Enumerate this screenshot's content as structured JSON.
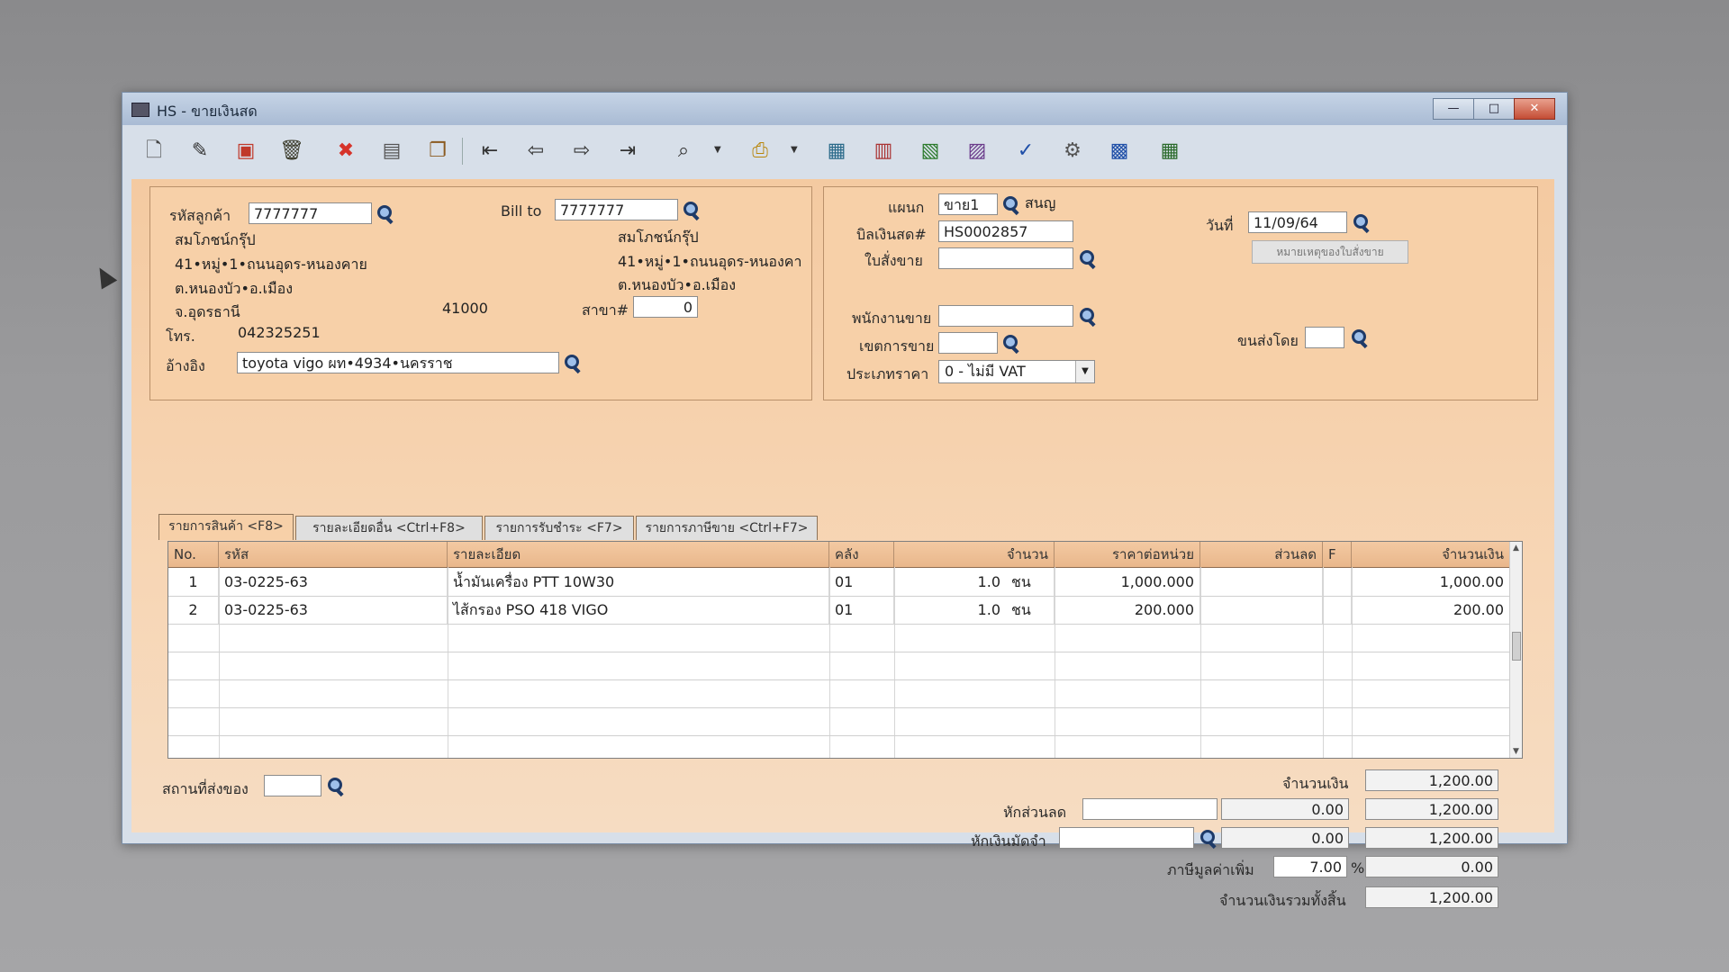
{
  "window": {
    "title": "HS - ขายเงินสด",
    "min": "—",
    "max": "□",
    "close": "✕"
  },
  "toolbar": [
    {
      "name": "new-document-icon",
      "glyph": "🗋"
    },
    {
      "name": "edit-icon",
      "glyph": "✎"
    },
    {
      "name": "void-icon",
      "glyph": "▣"
    },
    {
      "name": "delete-bin-icon",
      "glyph": "🗑"
    },
    {
      "name": "cancel-icon",
      "glyph": "✖"
    },
    {
      "name": "save-icon",
      "glyph": "▤"
    },
    {
      "name": "copy-icon",
      "glyph": "❐"
    },
    {
      "name": "first-record-icon",
      "glyph": "⇤"
    },
    {
      "name": "previous-record-icon",
      "glyph": "⇦"
    },
    {
      "name": "next-record-icon",
      "glyph": "⇨"
    },
    {
      "name": "last-record-icon",
      "glyph": "⇥"
    },
    {
      "name": "find-icon",
      "glyph": "⌕"
    },
    {
      "name": "print-icon",
      "glyph": "⎙"
    },
    {
      "name": "report-icon",
      "glyph": "▦"
    },
    {
      "name": "form-icon",
      "glyph": "▥"
    },
    {
      "name": "sign-icon",
      "glyph": "▧"
    },
    {
      "name": "rejection-icon",
      "glyph": "▨"
    },
    {
      "name": "approve-icon",
      "glyph": "✓"
    },
    {
      "name": "tools-icon",
      "glyph": "⚙"
    },
    {
      "name": "ok-document-icon",
      "glyph": "▩"
    },
    {
      "name": "calculator-icon",
      "glyph": "▦"
    }
  ],
  "customer": {
    "code_label": "รหัสลูกค้า",
    "code": "7777777",
    "name": "สมโภชน์กรุ๊ป",
    "addr1": "41•หมู่•1•ถนนอุดร-หนองคาย",
    "addr2": "ต.หนองบัว•อ.เมือง",
    "province": "จ.อุดรธานี",
    "postcode": "41000",
    "tel_label": "โทร.",
    "tel": "042325251",
    "ref_label": "อ้างอิง",
    "ref": "toyota vigo ผท•4934•นครราช"
  },
  "bill_to": {
    "label": "Bill to",
    "code": "7777777",
    "name": "สมโภชน์กรุ๊ป",
    "addr1": "41•หมู่•1•ถนนอุดร-หนองคา",
    "addr2": "ต.หนองบัว•อ.เมือง",
    "branch_label": "สาขา#",
    "branch": "0"
  },
  "doc": {
    "dept_label": "แผนก",
    "dept": "ขาย1",
    "dept_name": "สนญ",
    "bill_label": "บิลเงินสด#",
    "bill_no": "HS0002857",
    "order_label": "ใบสั่งขาย",
    "order": "",
    "date_label": "วันที่",
    "date": "11/09/64",
    "note_button": "หมายเหตุของใบสั่งขาย",
    "salesman_label": "พนักงานขาย",
    "salesman": "",
    "area_label": "เขตการขาย",
    "area": "",
    "ship_label": "ขนส่งโดย",
    "ship": "",
    "price_type_label": "ประเภทราคา",
    "price_type": "0 - ไม่มี VAT"
  },
  "tabs": [
    "รายการสินค้า <F8>",
    "รายละเอียดอื่น <Ctrl+F8>",
    "รายการรับชำระ <F7>",
    "รายการภาษีขาย <Ctrl+F7>"
  ],
  "grid": {
    "headers": [
      "No.",
      "รหัส",
      "รายละเอียด",
      "คลัง",
      "จำนวน",
      "ราคาต่อหน่วย",
      "ส่วนลด",
      "F",
      "จำนวนเงิน"
    ],
    "rows": [
      {
        "no": "1",
        "code": "03-0225-63",
        "desc": "น้ำมันเครื่อง PTT 10W30",
        "wh": "01",
        "qty": "1.0",
        "unit": "ชน",
        "price": "1,000.000",
        "disc": "",
        "f": "",
        "amount": "1,000.00"
      },
      {
        "no": "2",
        "code": "03-0225-63",
        "desc": "ไส้กรอง PSO 418 VIGO",
        "wh": "01",
        "qty": "1.0",
        "unit": "ชน",
        "price": "200.000",
        "disc": "",
        "f": "",
        "amount": "200.00"
      }
    ]
  },
  "footer": {
    "ship_place_label": "สถานที่ส่งของ",
    "ship_place": "",
    "amount_label": "จำนวนเงิน",
    "amount": "1,200.00",
    "discount_label": "หักส่วนลด",
    "discount_input": "",
    "discount_value": "0.00",
    "after_discount": "1,200.00",
    "deposit_label": "หักเงินมัดจำ",
    "deposit_input": "",
    "deposit_value": "0.00",
    "after_deposit": "1,200.00",
    "vat_label": "ภาษีมูลค่าเพิ่ม",
    "vat_rate": "7.00",
    "vat_pct": "%",
    "vat_amount": "0.00",
    "total_label": "จำนวนเงินรวมทั้งสิ้น",
    "total": "1,200.00"
  }
}
